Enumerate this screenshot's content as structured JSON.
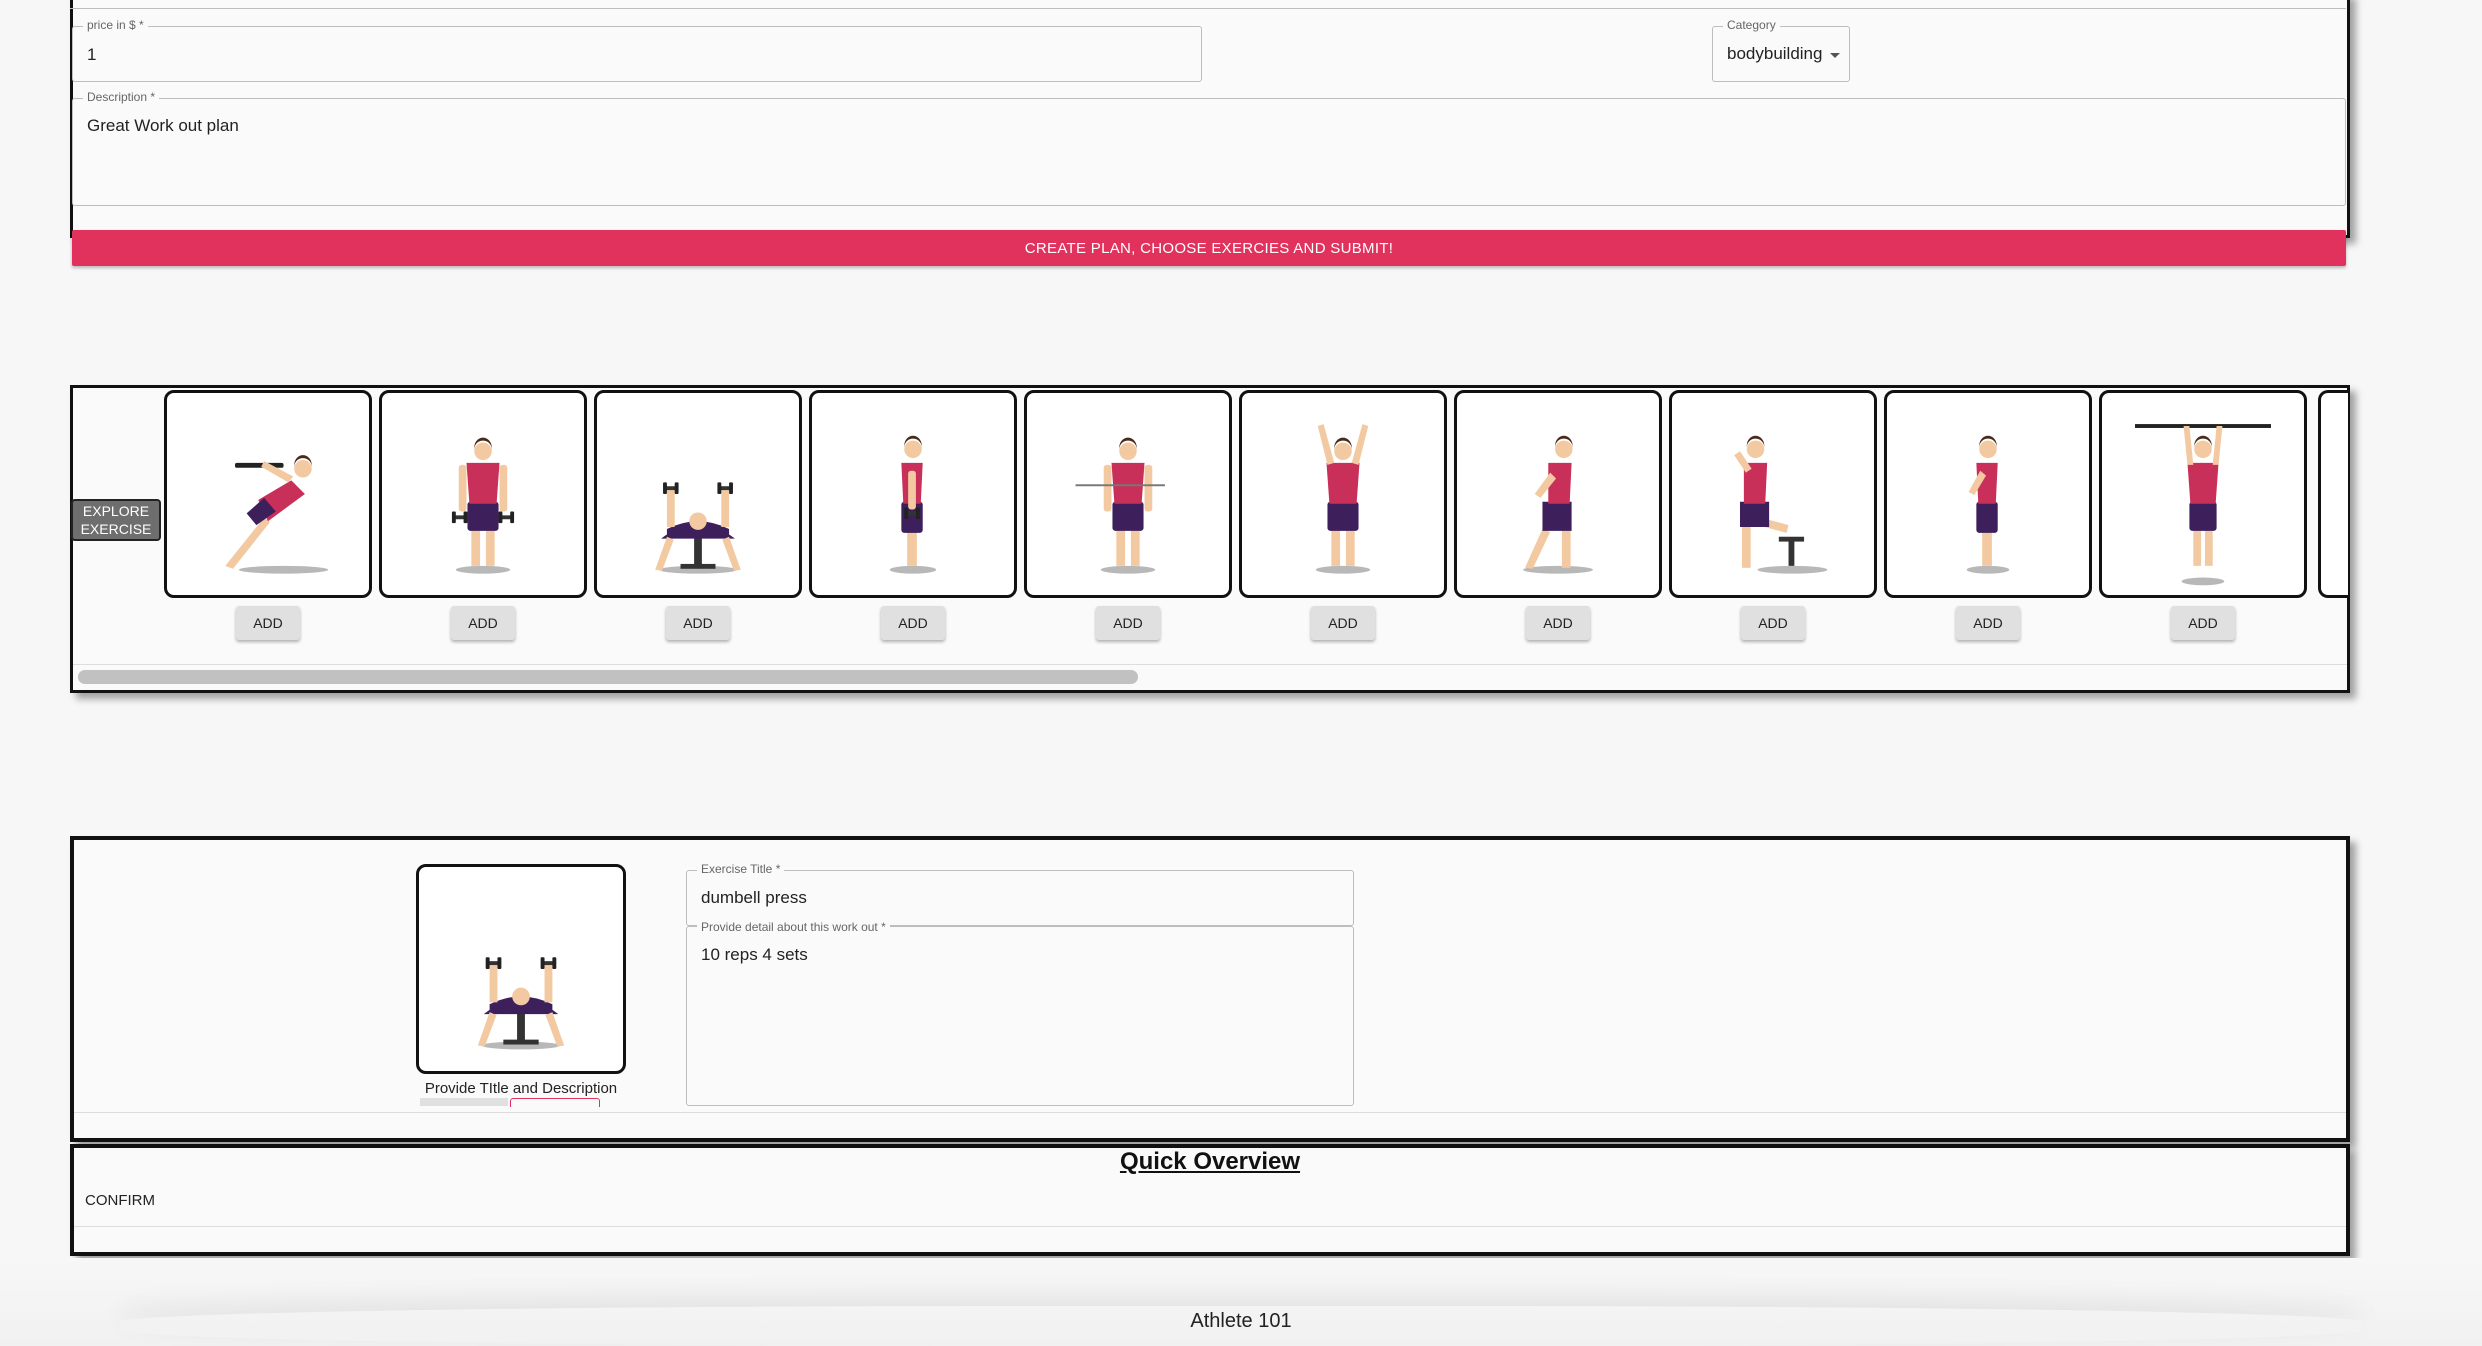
{
  "plan_form": {
    "price_label": "price in $ *",
    "price_value": "1",
    "category_label": "Category",
    "category_value": "bodybuilding",
    "description_label": "Description *",
    "description_value": "Great Work out plan",
    "submit_label": "CREATE PLAN, CHOOSE EXERCIES AND SUBMIT!"
  },
  "carousel": {
    "explore_label": [
      "EXPLORE",
      "EXERCISE"
    ],
    "add_label": "ADD",
    "exercises": [
      {
        "icon": "incline-pullup-figure-icon"
      },
      {
        "icon": "dumbbell-hold-figure-icon"
      },
      {
        "icon": "bench-press-figure-icon"
      },
      {
        "icon": "side-dumbbell-figure-icon"
      },
      {
        "icon": "band-pull-figure-icon"
      },
      {
        "icon": "arms-up-jump-figure-icon"
      },
      {
        "icon": "lunge-figure-icon"
      },
      {
        "icon": "step-up-figure-icon"
      },
      {
        "icon": "standing-figure-icon"
      },
      {
        "icon": "overhead-bar-figure-icon"
      }
    ]
  },
  "editor": {
    "image_caption": "Provide TItle and Description",
    "title_label": "Exercise Title *",
    "title_value": "dumbell press",
    "detail_label": "Provide detail about this work out *",
    "detail_value": "10 reps 4 sets"
  },
  "overview": {
    "heading": "Quick Overview",
    "confirm_label": "CONFIRM"
  },
  "footer": {
    "text": "Athlete 101"
  },
  "colors": {
    "accent": "#e0325c",
    "shirt": "#c8305a",
    "shorts": "#3d1f5c",
    "skin": "#f2c9a0",
    "hair": "#4a2a1a"
  }
}
